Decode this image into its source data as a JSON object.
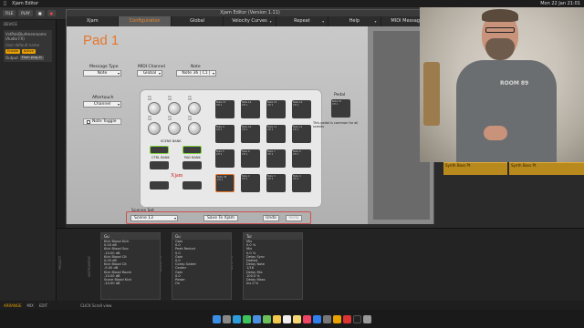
{
  "menubar": {
    "app": "Xjam Editor",
    "clock": "Mon 22 Jan 21:01"
  },
  "host": {
    "top_buttons": [
      "FILE",
      "PLAY"
    ],
    "device_title": "DEVICE",
    "device_name": "VstPolsBluAmenrooms (Audio FX)",
    "user_default": "User default name",
    "enable_label": "Enable",
    "active_label": "Active",
    "output_label": "Output",
    "output_value": "From plug-in",
    "arrange_clips": [
      "Synth Bass Pt",
      "Synth Bass Pt"
    ],
    "bottom_tabs": [
      "ARRANGE",
      "MIX",
      "EDIT"
    ],
    "bottom_hint": "CLICK  Scroll  view"
  },
  "xjam": {
    "window_title": "Xjam Editor (Version 1.11)",
    "tabs": [
      {
        "label": "Xjam",
        "active": false
      },
      {
        "label": "Configuration",
        "active": true
      },
      {
        "label": "Global",
        "active": false
      },
      {
        "label": "Velocity Curves",
        "active": false
      },
      {
        "label": "Repeat",
        "active": false
      },
      {
        "label": "Help",
        "active": false
      },
      {
        "label": "MIDI Message",
        "active": false
      }
    ],
    "pad_title": "Pad 1",
    "message_type_label": "Message Type",
    "message_type_value": "Note",
    "midi_channel_label": "MIDI Channel",
    "midi_channel_value": "Global",
    "note_label": "Note",
    "note_value": "Note 36 | C1 |",
    "aftertouch_label": "Aftertouch",
    "aftertouch_value": "Channel",
    "note_toggle_label": "Note Toggle",
    "pedal_label": "Pedal",
    "pedal_note": "This pedal is common for all scenes",
    "scene_bank_label": "SCENE BANK",
    "ctrl_bank_label": "CTRL BANK",
    "pad_bank_label": "PAD BANK",
    "logo": "Xjam",
    "scenes_set_label": "Scenes Set",
    "scene_value": "Scene 13",
    "save_btn": "Save To Xjam",
    "undo_btn": "Undo",
    "redo_btn": "Redo"
  },
  "video": {
    "shirt_text": "ROOM 89"
  },
  "devices": {
    "panels": [
      {
        "title": "Gu",
        "rows": [
          "Kick Blood Kick",
          "0.00 dB",
          "Kick Blood Sno",
          "-10.00 dB",
          "Kick Blood Clt",
          "0.00 dB",
          "Kick Blood Clt",
          "-9.00 dB",
          "Kick Blood Room",
          "-10.00 dB",
          "Snare Blood Kick",
          "-10.00 dB"
        ]
      },
      {
        "title": "Gu",
        "rows": [
          "Gain",
          "0.0",
          "Peak Reduct",
          "0.0",
          "Gain",
          "0.0",
          "Comp Gated",
          "Center",
          "Gain",
          "0.0",
          "Power",
          "On"
        ]
      },
      {
        "title": "Tur",
        "rows": [
          "Mix",
          "0.0 %",
          "Mix",
          "0.0 %",
          "Delay Sync",
          "Dotted",
          "Delay Note",
          "1/16",
          "Delay Mix",
          "100.0 %",
          "Delay Mass",
          "Ins 0 %"
        ]
      }
    ],
    "side_labels": [
      "PROJECT",
      "INSTRUMENT",
      "AUDIO FX",
      "NOTE FX"
    ]
  }
}
